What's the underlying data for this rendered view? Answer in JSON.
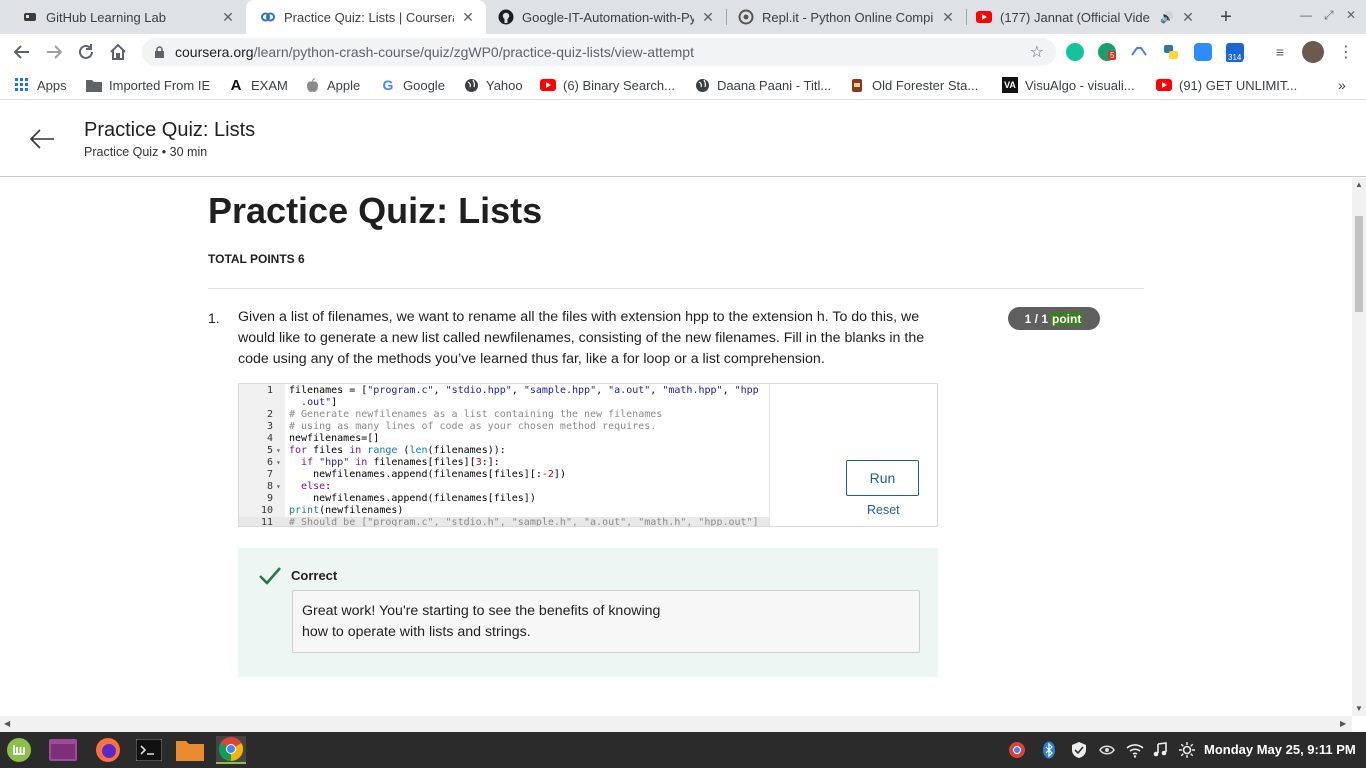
{
  "browser": {
    "tabs": [
      {
        "title": "GitHub Learning Lab",
        "icon": "github-icon"
      },
      {
        "title": "Practice Quiz: Lists | Coursera",
        "icon": "coursera-icon",
        "active": true
      },
      {
        "title": "Google-IT-Automation-with-Py",
        "icon": "github-icon"
      },
      {
        "title": "Repl.it - Python Online Compil",
        "icon": "replit-icon"
      },
      {
        "title": "(177) Jannat (Official Vide",
        "icon": "youtube-icon"
      }
    ],
    "url_host": "coursera.org",
    "url_path": "/learn/python-crash-course/quiz/zgWP0/practice-quiz-lists/view-attempt",
    "ext_badges": {
      "grammarly_count": "5",
      "calendar_count": "314"
    },
    "bookmarks": [
      {
        "label": "Apps",
        "icon": "apps-grid-icon"
      },
      {
        "label": "Imported From IE",
        "icon": "folder-icon"
      },
      {
        "label": "EXAM",
        "icon": "exam-logo-icon"
      },
      {
        "label": "Apple",
        "icon": "apple-icon"
      },
      {
        "label": "Google",
        "icon": "google-icon"
      },
      {
        "label": "Yahoo",
        "icon": "globe-icon"
      },
      {
        "label": "(6) Binary Search...",
        "icon": "youtube-icon"
      },
      {
        "label": "Daana Paani - Titl...",
        "icon": "globe-icon"
      },
      {
        "label": "Old Forester Sta...",
        "icon": "oldforester-icon"
      },
      {
        "label": "VisuAlgo - visuali...",
        "icon": "visualgo-icon"
      },
      {
        "label": "(91) GET UNLIMIT...",
        "icon": "youtube-icon"
      }
    ]
  },
  "header": {
    "title": "Practice Quiz: Lists",
    "subtitle": "Practice Quiz • 30 min"
  },
  "quiz": {
    "heading": "Practice Quiz: Lists",
    "total_points": "TOTAL POINTS 6",
    "question": {
      "number": "1.",
      "text": "Given a list of filenames, we want to rename all the files with extension hpp to the extension h. To do this, we would like to generate a new list called newfilenames, consisting of the new filenames. Fill in the blanks in the code using any of the methods you’ve learned thus far, like a for loop or a list comprehension.",
      "score_prefix": "1 / 1",
      "score_suffix": "point"
    },
    "code_lines": [
      {
        "n": "1",
        "fold": false,
        "html": "filenames = [<span class='c-str'>\"program.c\"</span>, <span class='c-str'>\"stdio.hpp\"</span>, <span class='c-str'>\"sample.hpp\"</span>, <span class='c-str'>\"a.out\"</span>, <span class='c-str'>\"math.hpp\"</span>, <span class='c-str'>\"hpp</span>"
      },
      {
        "n": "",
        "fold": false,
        "html": "  <span class='c-str'>.out\"</span>]"
      },
      {
        "n": "2",
        "fold": false,
        "html": "<span class='c-com'># Generate newfilenames as a list containing the new filenames</span>"
      },
      {
        "n": "3",
        "fold": false,
        "html": "<span class='c-com'># using as many lines of code as your chosen method requires.</span>"
      },
      {
        "n": "4",
        "fold": false,
        "html": "newfilenames=[]"
      },
      {
        "n": "5",
        "fold": true,
        "html": "<span class='c-kw'>for</span> files <span class='c-kw'>in</span> <span class='c-fn'>range</span> (<span class='c-fn'>len</span>(filenames)):"
      },
      {
        "n": "6",
        "fold": true,
        "html": "  <span class='c-kw'>if</span> <span class='c-str'>\"hpp\"</span> <span class='c-kw'>in</span> filenames[files][<span class='c-num'>3</span>:]:"
      },
      {
        "n": "7",
        "fold": false,
        "html": "    newfilenames.append(filenames[files][:<span class='c-num'>-2</span>])"
      },
      {
        "n": "8",
        "fold": true,
        "html": "  <span class='c-kw'>else</span>:"
      },
      {
        "n": "9",
        "fold": false,
        "html": "    newfilenames.append(filenames[files])"
      },
      {
        "n": "10",
        "fold": false,
        "html": "<span class='c-fn'>print</span>(newfilenames)"
      },
      {
        "n": "11",
        "fold": false,
        "html": "<span class='c-com'># Should be [\"program.c\", \"stdio.h\", \"sample.h\", \"a.out\", \"math.h\", \"hpp.out\"]</span>"
      }
    ],
    "run_label": "Run",
    "reset_label": "Reset",
    "feedback_status": "Correct",
    "feedback_line1": "Great work! You're starting to see the benefits of knowing",
    "feedback_line2": "how to operate with lists and strings."
  },
  "taskbar": {
    "clock": "Monday May 25, 9:11 PM"
  },
  "colors": {
    "accent_blue": "#1f5d9c",
    "success_green": "#3f7a25",
    "feedback_bg": "#eef6f3"
  }
}
